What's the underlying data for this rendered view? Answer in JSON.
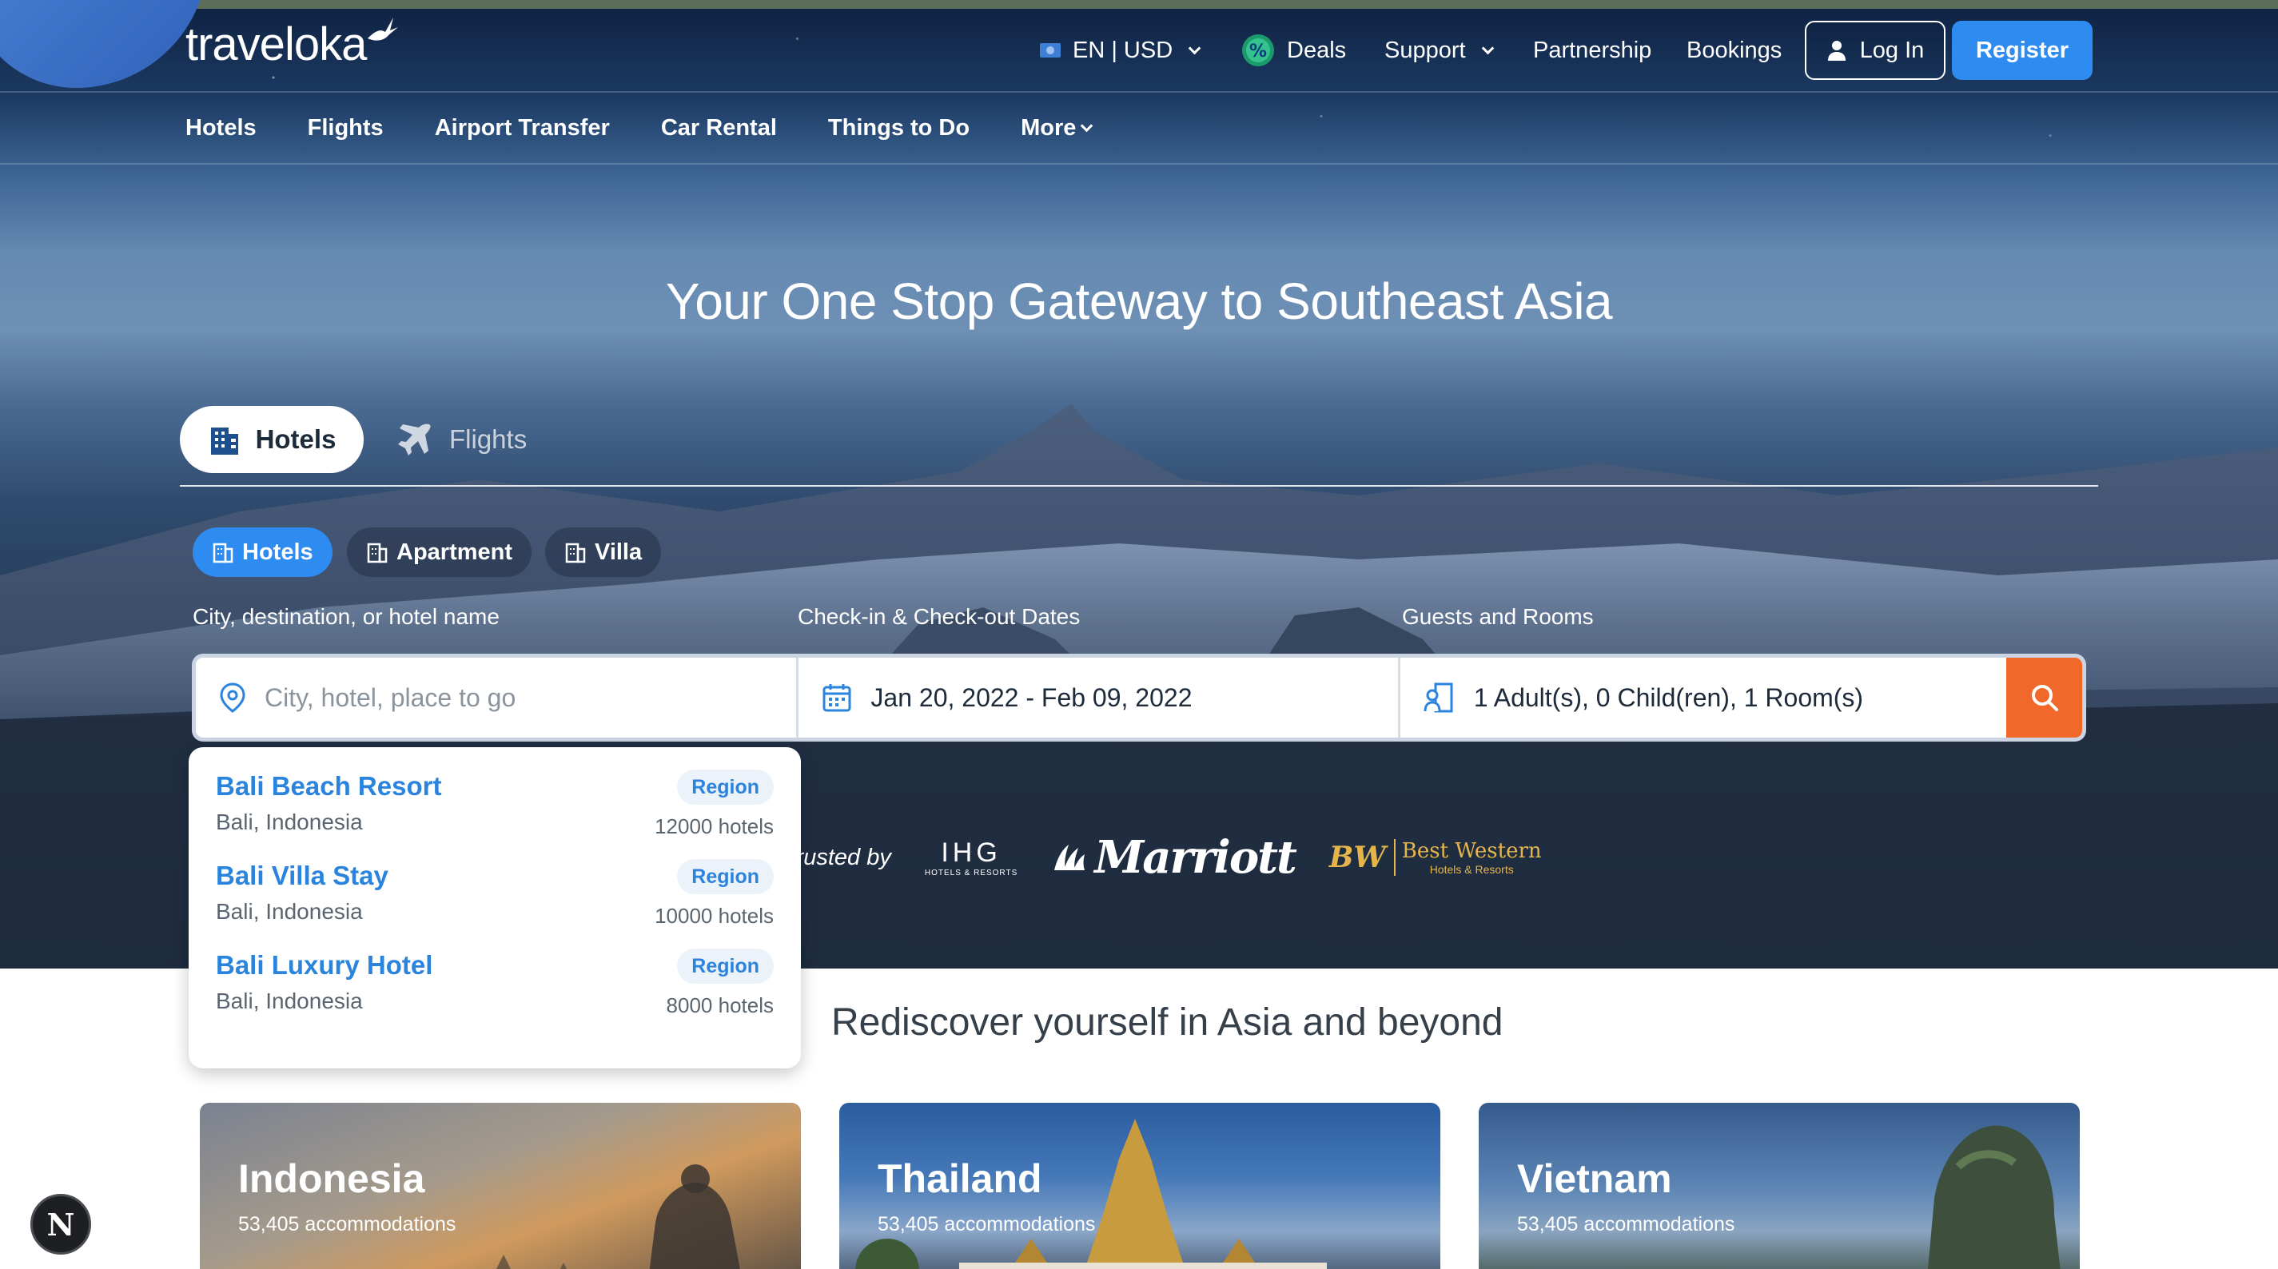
{
  "brand": {
    "logo_text": "traveloka"
  },
  "topnav": {
    "locale": "EN | USD",
    "deals": "Deals",
    "support": "Support",
    "partnership": "Partnership",
    "bookings": "Bookings",
    "login": "Log In",
    "register": "Register"
  },
  "subnav": {
    "items": [
      "Hotels",
      "Flights",
      "Airport Transfer",
      "Car Rental",
      "Things to Do",
      "More"
    ]
  },
  "hero": {
    "headline": "Your One Stop Gateway to Southeast Asia"
  },
  "product_tabs": {
    "active": "Hotels",
    "inactive": "Flights"
  },
  "accommodation_types": {
    "active": "Hotels",
    "apartment": "Apartment",
    "villa": "Villa"
  },
  "search": {
    "dest_label": "City, destination, or hotel name",
    "dest_placeholder": "City, hotel, place to go",
    "dates_label": "Check-in & Check-out Dates",
    "dates_value": "Jan 20, 2022 - Feb 09, 2022",
    "guests_label": "Guests and Rooms",
    "guests_value": "1 Adult(s), 0 Child(ren), 1 Room(s)"
  },
  "trusted": {
    "label": "Trusted by",
    "ihg_main": "IHG",
    "ihg_sub": "HOTELS & RESORTS",
    "marriott": "Marriott",
    "bw_mark": "BW",
    "bw_name": "Best Western",
    "bw_sub": "Hotels & Resorts"
  },
  "suggestions": [
    {
      "name": "Bali Beach Resort",
      "location": "Bali, Indonesia",
      "type": "Region",
      "count": "12000 hotels"
    },
    {
      "name": "Bali Villa Stay",
      "location": "Bali, Indonesia",
      "type": "Region",
      "count": "10000 hotels"
    },
    {
      "name": "Bali Luxury Hotel",
      "location": "Bali, Indonesia",
      "type": "Region",
      "count": "8000 hotels"
    }
  ],
  "section": {
    "title": "Rediscover yourself in Asia and beyond"
  },
  "destinations": [
    {
      "name": "Indonesia",
      "count": "53,405 accommodations"
    },
    {
      "name": "Thailand",
      "count": "53,405 accommodations"
    },
    {
      "name": "Vietnam",
      "count": "53,405 accommodations"
    }
  ],
  "dev_badge": "N",
  "colors": {
    "primary": "#2e8bf0",
    "search_button": "#f0682a",
    "link": "#2a84de"
  }
}
